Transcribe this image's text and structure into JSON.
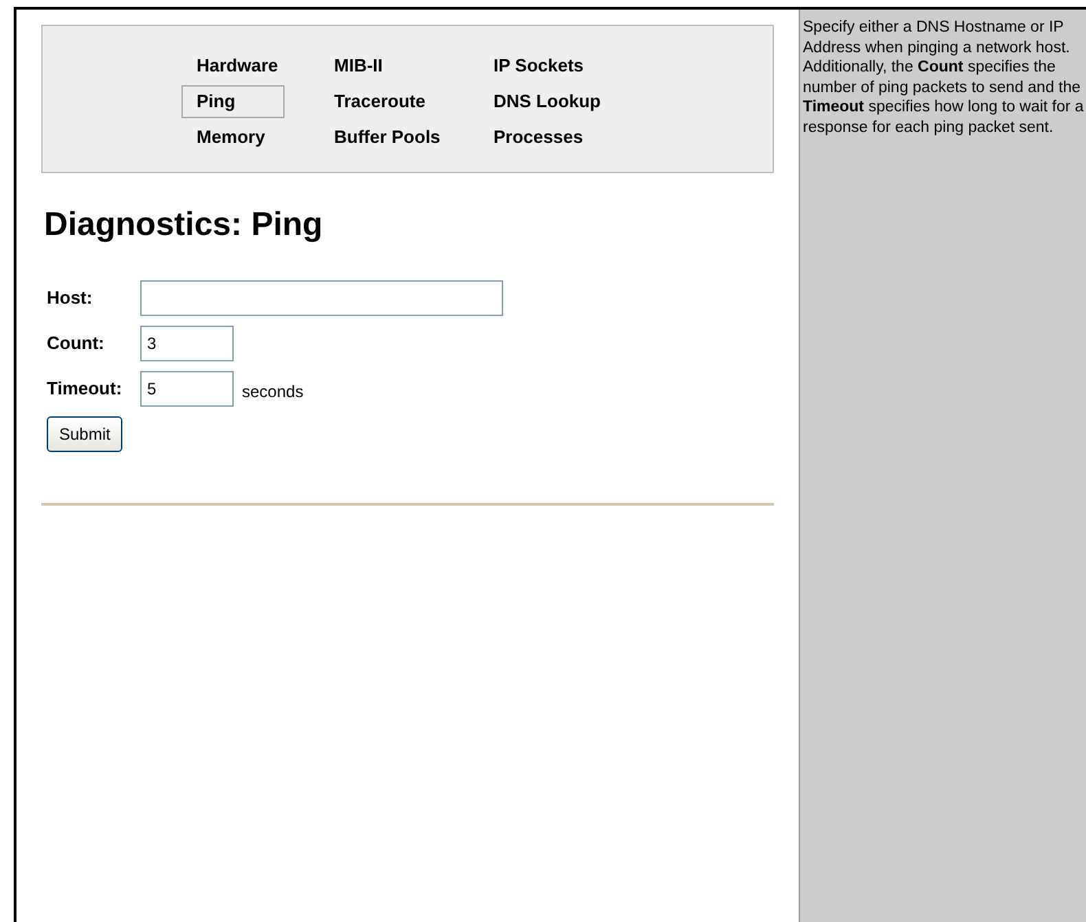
{
  "nav": {
    "columns": [
      [
        {
          "label": "Hardware",
          "selected": false
        },
        {
          "label": "Ping",
          "selected": true
        },
        {
          "label": "Memory",
          "selected": false
        }
      ],
      [
        {
          "label": "MIB-II",
          "selected": false
        },
        {
          "label": "Traceroute",
          "selected": false
        },
        {
          "label": "Buffer Pools",
          "selected": false
        }
      ],
      [
        {
          "label": "IP Sockets",
          "selected": false
        },
        {
          "label": "DNS Lookup",
          "selected": false
        },
        {
          "label": "Processes",
          "selected": false
        }
      ]
    ]
  },
  "heading": "Diagnostics: Ping",
  "form": {
    "fields": [
      {
        "label": "Host:",
        "kind": "long"
      },
      {
        "label": "Count:",
        "value": "3",
        "kind": "short"
      },
      {
        "label": "Timeout:",
        "value": "5",
        "kind": "short",
        "unit": "seconds"
      }
    ],
    "submit": "Submit"
  },
  "help": "Specify either a DNS Hostname or IP Address when pinging a network host. Additionally, the **Count** specifies the number of ping packets to send and the **Timeout** specifies how long to wait for a response for each ping packet sent."
}
